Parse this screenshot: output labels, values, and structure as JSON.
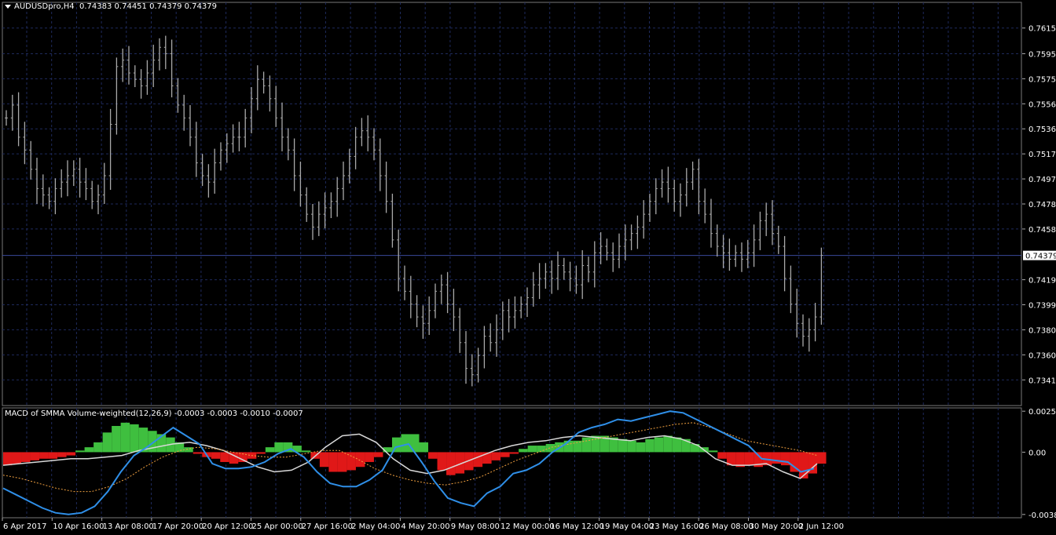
{
  "header": {
    "symbol": "AUDUSDpro,H4",
    "ohlc": "0.74383 0.74451 0.74379 0.74379"
  },
  "indicator": {
    "label": "MACD of SMMA Volume-weighted(12,26,9) -0.0003 -0.0003 -0.0010 -0.0007"
  },
  "colors": {
    "background": "#000000",
    "grid": "#1e2a5c",
    "candles": "#a9a9a9",
    "histogram_up": "#3fbf3f",
    "histogram_down": "#e01818",
    "macd_line": "#2f8fe8",
    "signal_line": "#f0a040",
    "blend_line": "#d8d8d8",
    "bid_line": "#3a4a9a"
  },
  "chart_data": [
    {
      "type": "candlestick",
      "title": "AUDUSDpro,H4",
      "price_axis": [
        "0.76150",
        "0.75950",
        "0.75755",
        "0.75560",
        "0.75365",
        "0.75170",
        "0.74975",
        "0.74780",
        "0.74585",
        "0.74379",
        "0.74190",
        "0.73995",
        "0.73800",
        "0.73605",
        "0.73410"
      ],
      "ylim": [
        0.7321,
        0.7635
      ],
      "current_price": "0.74379",
      "x_labels": [
        "6 Apr 2017",
        "10 Apr 16:00",
        "13 Apr 08:00",
        "17 Apr 20:00",
        "20 Apr 12:00",
        "25 Apr 00:00",
        "27 Apr 16:00",
        "2 May 04:00",
        "4 May 20:00",
        "9 May 08:00",
        "12 May 00:00",
        "16 May 12:00",
        "19 May 04:00",
        "23 May 16:00",
        "26 May 08:00",
        "30 May 20:00",
        "2 Jun 12:00"
      ],
      "closes": [
        0.7545,
        0.7555,
        0.753,
        0.752,
        0.7505,
        0.749,
        0.7485,
        0.748,
        0.749,
        0.7495,
        0.75,
        0.7505,
        0.7495,
        0.749,
        0.748,
        0.7485,
        0.75,
        0.754,
        0.7585,
        0.759,
        0.758,
        0.7575,
        0.757,
        0.758,
        0.759,
        0.76,
        0.7595,
        0.757,
        0.7555,
        0.7545,
        0.753,
        0.751,
        0.75,
        0.7495,
        0.751,
        0.752,
        0.7525,
        0.753,
        0.753,
        0.7545,
        0.756,
        0.7575,
        0.757,
        0.756,
        0.7545,
        0.753,
        0.752,
        0.75,
        0.7485,
        0.747,
        0.746,
        0.747,
        0.7475,
        0.748,
        0.749,
        0.75,
        0.7515,
        0.753,
        0.7535,
        0.753,
        0.752,
        0.75,
        0.748,
        0.745,
        0.742,
        0.741,
        0.74,
        0.739,
        0.7385,
        0.7395,
        0.741,
        0.7415,
        0.74,
        0.739,
        0.737,
        0.735,
        0.7345,
        0.736,
        0.7375,
        0.737,
        0.738,
        0.7395,
        0.739,
        0.7395,
        0.74,
        0.7405,
        0.7415,
        0.742,
        0.7425,
        0.742,
        0.743,
        0.7425,
        0.742,
        0.7415,
        0.743,
        0.7425,
        0.744,
        0.7445,
        0.744,
        0.7435,
        0.7445,
        0.745,
        0.7455,
        0.746,
        0.747,
        0.748,
        0.749,
        0.7495,
        0.749,
        0.748,
        0.7485,
        0.7495,
        0.7505,
        0.748,
        0.747,
        0.7455,
        0.7445,
        0.744,
        0.7435,
        0.744,
        0.7435,
        0.744,
        0.745,
        0.7465,
        0.747,
        0.7455,
        0.7445,
        0.742,
        0.74,
        0.7385,
        0.7375,
        0.738,
        0.739,
        0.7438
      ]
    },
    {
      "type": "histogram+line",
      "title": "MACD of SMMA Volume-weighted(12,26,9)",
      "y_axis": [
        "0.0025",
        "0.00",
        "-0.0038"
      ],
      "ylim": [
        -0.004,
        0.0027
      ],
      "histogram": [
        -0.0008,
        -0.0007,
        -0.0006,
        -0.0005,
        -0.0004,
        -0.0004,
        -0.0003,
        -0.0002,
        0.0001,
        0.0003,
        0.0006,
        0.0012,
        0.0016,
        0.0018,
        0.0017,
        0.0015,
        0.0013,
        0.0011,
        0.0009,
        0.0006,
        0.0003,
        -0.0001,
        -0.0003,
        -0.0004,
        -0.0006,
        -0.0007,
        -0.0006,
        -0.0004,
        -0.0001,
        0.0003,
        0.0006,
        0.0006,
        0.0004,
        0.0001,
        -0.0004,
        -0.0009,
        -0.0012,
        -0.0012,
        -0.0011,
        -0.0009,
        -0.0006,
        -0.0003,
        0.0003,
        0.0009,
        0.0011,
        0.0011,
        0.0006,
        -0.0004,
        -0.0011,
        -0.0014,
        -0.0013,
        -0.0011,
        -0.0009,
        -0.0007,
        -0.0005,
        -0.0003,
        -0.0001,
        0.0002,
        0.0004,
        0.0004,
        0.0005,
        0.0006,
        0.0007,
        0.0007,
        0.0009,
        0.001,
        0.001,
        0.0009,
        0.0008,
        0.0007,
        0.0006,
        0.0008,
        0.0009,
        0.001,
        0.0009,
        0.0008,
        0.0005,
        0.0003,
        0.0001,
        -0.0004,
        -0.0008,
        -0.0009,
        -0.0008,
        -0.0009,
        -0.0008,
        -0.0007,
        -0.0008,
        -0.0012,
        -0.0016,
        -0.0013,
        -0.0007
      ],
      "series": [
        {
          "values": [
            -0.0022,
            -0.0026,
            -0.003,
            -0.0034,
            -0.0037,
            -0.0038,
            -0.0037,
            -0.0033,
            -0.0024,
            -0.0012,
            -0.0002,
            0.0003,
            0.0009,
            0.0015,
            0.001,
            0.0005,
            -0.0007,
            -0.001,
            -0.001,
            -0.0009,
            -0.0006,
            -0.0001,
            0.0002,
            -0.0003,
            -0.0012,
            -0.0019,
            -0.0021,
            -0.0021,
            -0.0017,
            -0.0011,
            0.0003,
            0.0005,
            -0.0006,
            -0.0018,
            -0.0028,
            -0.0031,
            -0.0033,
            -0.0025,
            -0.0021,
            -0.0013,
            -0.0011,
            -0.0007,
            0.0,
            0.0005,
            0.0012,
            0.0015,
            0.0017,
            0.002,
            0.0019,
            0.0021,
            0.0023,
            0.0025,
            0.0024,
            0.002,
            0.0016,
            0.0012,
            0.0008,
            0.0004,
            -0.0004,
            -0.0005,
            -0.0006,
            -0.0012,
            -0.001
          ]
        },
        {
          "values": [
            -0.0014,
            -0.0016,
            -0.0019,
            -0.0022,
            -0.0024,
            -0.0024,
            -0.0021,
            -0.0016,
            -0.0009,
            -0.0003,
            0.0001,
            0.0003,
            0.0002,
            0.0,
            -0.0002,
            -0.0003,
            -0.0003,
            -0.0001,
            0.0001,
            0.0001,
            -0.0004,
            -0.001,
            -0.0014,
            -0.0017,
            -0.0019,
            -0.002,
            -0.0018,
            -0.0015,
            -0.001,
            -0.0005,
            -0.0001,
            0.0003,
            0.0005,
            0.0007,
            0.0009,
            0.0011,
            0.0013,
            0.0015,
            0.0017,
            0.0018,
            0.0015,
            0.0011,
            0.0007,
            0.0005,
            0.0003,
            0.0001,
            -0.0002
          ]
        },
        {
          "values": [
            -0.0008,
            -0.0007,
            -0.0006,
            -0.0005,
            -0.0004,
            -0.0004,
            -0.0003,
            -0.0002,
            0.0001,
            0.0003,
            0.0005,
            0.0006,
            0.0004,
            0.0001,
            -0.0004,
            -0.0009,
            -0.0012,
            -0.0011,
            -0.0006,
            0.0003,
            0.001,
            0.0011,
            0.0006,
            -0.0004,
            -0.0011,
            -0.0013,
            -0.0011,
            -0.0007,
            -0.0003,
            0.0001,
            0.0004,
            0.0006,
            0.0007,
            0.0009,
            0.001,
            0.0009,
            0.0008,
            0.0007,
            0.0009,
            0.001,
            0.0008,
            0.0004,
            -0.0004,
            -0.0008,
            -0.0008,
            -0.0007,
            -0.0012,
            -0.0016,
            -0.0007
          ]
        }
      ]
    }
  ]
}
